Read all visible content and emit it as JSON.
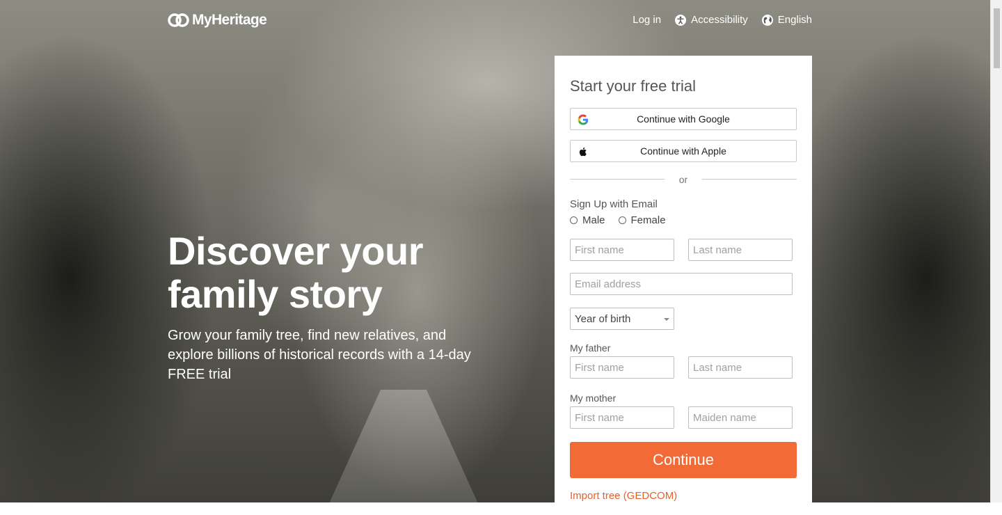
{
  "brand": {
    "name": "MyHeritage"
  },
  "nav": {
    "login": "Log in",
    "accessibility": "Accessibility",
    "language": "English"
  },
  "hero": {
    "headline_line1": "Discover your",
    "headline_line2": "family story",
    "subtitle": "Grow your family tree, find new relatives, and explore billions of historical records with a 14-day FREE trial"
  },
  "form": {
    "title": "Start your free trial",
    "google_label": "Continue with Google",
    "apple_label": "Continue with Apple",
    "or_label": "or",
    "email_signup_label": "Sign Up with Email",
    "gender_options": [
      "Male",
      "Female"
    ],
    "first_name_placeholder": "First name",
    "last_name_placeholder": "Last name",
    "email_placeholder": "Email address",
    "year_of_birth": "Year of birth",
    "father_label": "My father",
    "father_first_placeholder": "First name",
    "father_last_placeholder": "Last name",
    "mother_label": "My mother",
    "mother_first_placeholder": "First name",
    "mother_maiden_placeholder": "Maiden name",
    "continue_label": "Continue",
    "import_label": "Import tree (GEDCOM)"
  },
  "colors": {
    "accent": "#f26b36",
    "link": "#e5612a"
  }
}
